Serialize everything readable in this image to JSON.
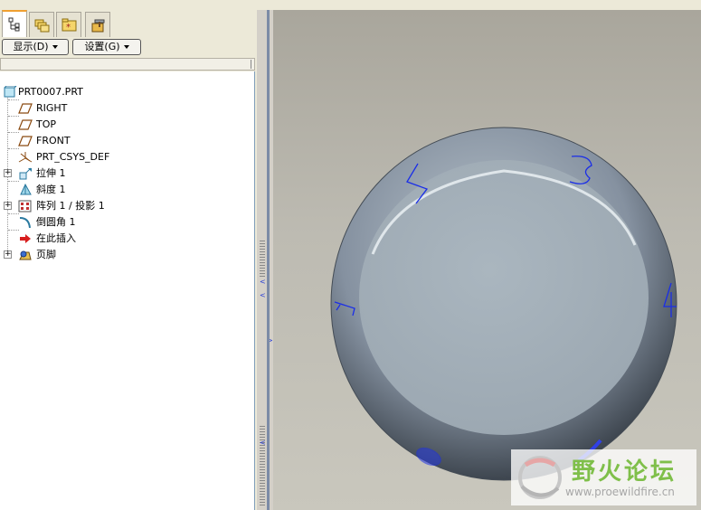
{
  "model_tree": {
    "tabs": [
      {
        "icon": "model-tree-icon",
        "active": true
      },
      {
        "icon": "folder-browser-icon",
        "active": false
      },
      {
        "icon": "favorites-icon",
        "active": false
      },
      {
        "icon": "connections-icon",
        "active": false
      }
    ],
    "toolbar": {
      "show_label": "显示(D)",
      "settings_label": "设置(G)"
    },
    "root": {
      "label": "PRT0007.PRT",
      "icon": "part-icon"
    },
    "items": [
      {
        "label": "RIGHT",
        "icon": "datum-plane-icon"
      },
      {
        "label": "TOP",
        "icon": "datum-plane-icon"
      },
      {
        "label": "FRONT",
        "icon": "datum-plane-icon"
      },
      {
        "label": "PRT_CSYS_DEF",
        "icon": "coordinate-system-icon"
      },
      {
        "label": "拉伸 1",
        "icon": "extrude-icon"
      },
      {
        "label": "斜度 1",
        "icon": "draft-icon"
      },
      {
        "label": "阵列 1 / 投影 1",
        "icon": "pattern-icon"
      },
      {
        "label": "倒圆角 1",
        "icon": "round-icon"
      },
      {
        "label": "在此插入",
        "icon": "insert-here-icon"
      },
      {
        "label": "页脚",
        "icon": "footer-icon"
      }
    ]
  },
  "model": {
    "face_colors": {
      "top": "#a6b3bb",
      "side": "#6f7c86",
      "edge": "#2f3740"
    },
    "projected_numbers": [
      "2",
      "3",
      "4",
      "1",
      "0",
      "9"
    ],
    "curve_color": "#1a2ee8"
  },
  "watermark": {
    "text": "野火论坛",
    "url": "www.proewildfire.cn"
  }
}
